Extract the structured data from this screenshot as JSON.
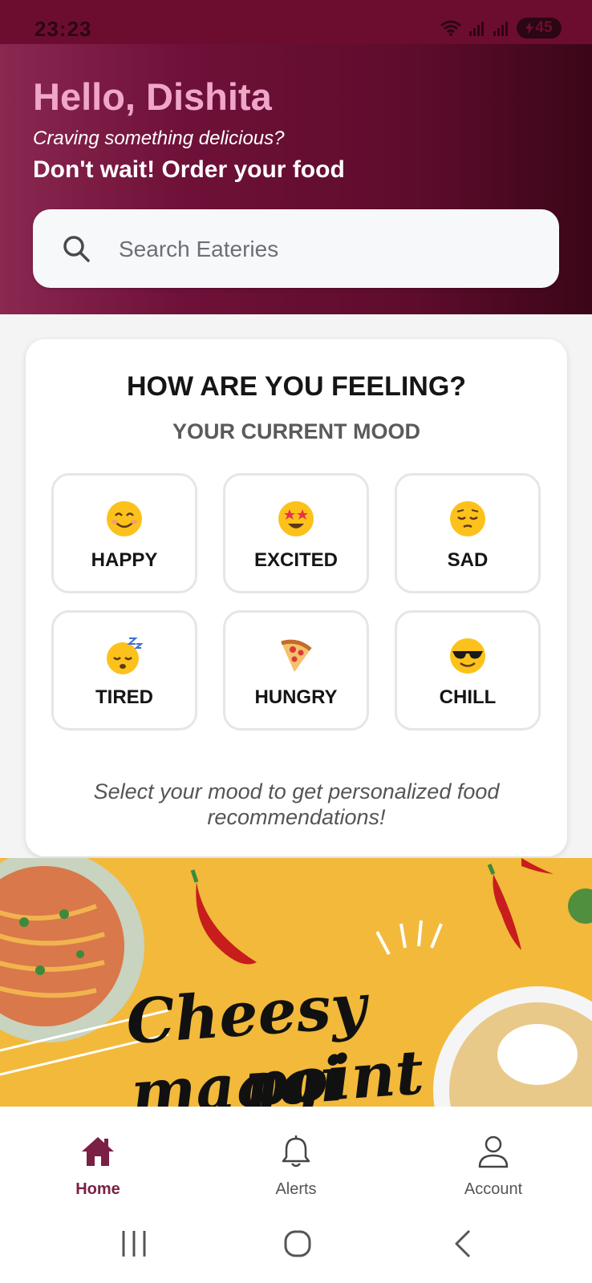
{
  "status_bar": {
    "time": "23:23",
    "battery": "45"
  },
  "header": {
    "greeting": "Hello, Dishita",
    "subtitle": "Craving something delicious?",
    "cta": "Don't wait! Order your food",
    "search_placeholder": "Search Eateries"
  },
  "mood": {
    "title": "HOW ARE YOU FEELING?",
    "subtitle": "YOUR CURRENT MOOD",
    "options": [
      {
        "label": "HAPPY",
        "icon": "smiling-face-icon"
      },
      {
        "label": "EXCITED",
        "icon": "star-struck-face-icon"
      },
      {
        "label": "SAD",
        "icon": "pensive-face-icon"
      },
      {
        "label": "TIRED",
        "icon": "sleeping-face-icon"
      },
      {
        "label": "HUNGRY",
        "icon": "pizza-slice-icon"
      },
      {
        "label": "CHILL",
        "icon": "sunglasses-face-icon"
      }
    ],
    "hint": "Select your mood to get personalized food recommendations!"
  },
  "banner": {
    "line1": "Cheesy maggi",
    "line2": "point"
  },
  "bottom_nav": {
    "items": [
      {
        "label": "Home",
        "icon": "home-icon",
        "active": true
      },
      {
        "label": "Alerts",
        "icon": "bell-icon",
        "active": false
      },
      {
        "label": "Account",
        "icon": "user-icon",
        "active": false
      }
    ]
  },
  "colors": {
    "brand": "#6c0d30",
    "greeting": "#f0a6c9",
    "active_nav": "#7b1f45",
    "banner_bg": "#f2b93b"
  }
}
